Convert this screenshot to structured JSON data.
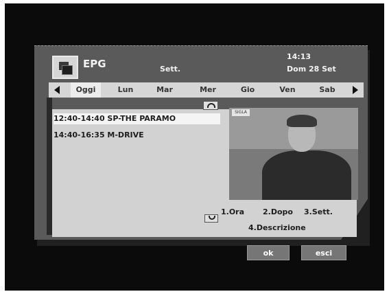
{
  "header": {
    "title": "EPG",
    "view_mode": "Sett.",
    "time": "14:13",
    "date": "Dom 28 Set"
  },
  "days": [
    {
      "label": "Oggi",
      "selected": true
    },
    {
      "label": "Lun"
    },
    {
      "label": "Mar"
    },
    {
      "label": "Mer"
    },
    {
      "label": "Gio"
    },
    {
      "label": "Ven"
    },
    {
      "label": "Sab"
    }
  ],
  "programs": [
    {
      "text": "12:40-14:40 SP-THE PARAMO",
      "selected": true
    },
    {
      "text": "14:40-16:35 M-DRIVE"
    }
  ],
  "video": {
    "channel_logo": "SIGLA"
  },
  "legend": {
    "ora": "1.Ora",
    "dopo": "2.Dopo",
    "sett": "3.Sett.",
    "descrizione": "4.Descrizione"
  },
  "buttons": {
    "ok": "ok",
    "exit": "esci"
  },
  "icons": {
    "epg": "epg-icon",
    "left": "arrow-left-icon",
    "right": "arrow-right-icon",
    "up": "scroll-up-icon",
    "down": "scroll-down-icon"
  }
}
